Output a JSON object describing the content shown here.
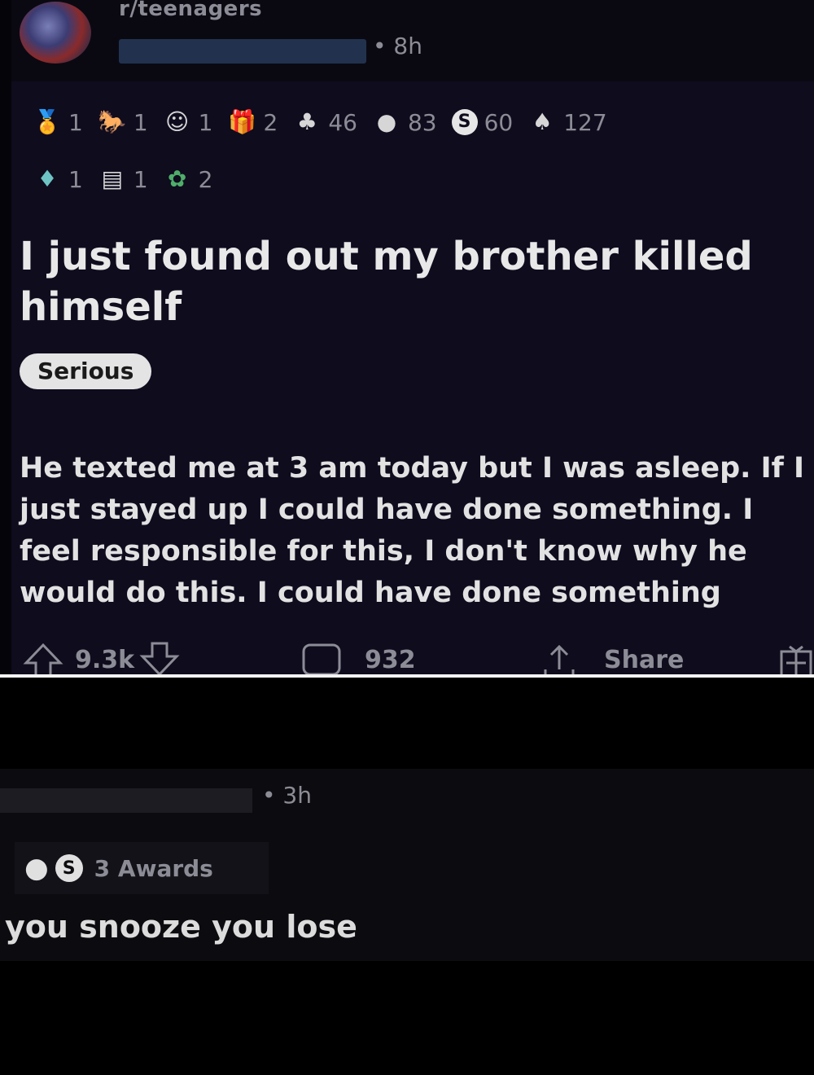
{
  "post": {
    "subreddit": "r/teenagers",
    "time": "• 8h",
    "awards_row1": [
      {
        "icon": "medal-icon",
        "glyph": "🏅",
        "count": "1",
        "tone": "gold"
      },
      {
        "icon": "horse-icon",
        "glyph": "🐎",
        "count": "1",
        "tone": ""
      },
      {
        "icon": "face-icon",
        "glyph": "☺",
        "count": "1",
        "tone": ""
      },
      {
        "icon": "gift-icon",
        "glyph": "🎁",
        "count": "2",
        "tone": ""
      },
      {
        "icon": "helpful-icon",
        "glyph": "♣",
        "count": "46",
        "tone": ""
      },
      {
        "icon": "wholesome-icon",
        "glyph": "●",
        "count": "83",
        "tone": ""
      },
      {
        "icon": "silver-coin-icon",
        "glyph": "S",
        "count": "60",
        "tone": "coin"
      },
      {
        "icon": "hug-icon",
        "glyph": "♠",
        "count": "127",
        "tone": ""
      }
    ],
    "awards_row2": [
      {
        "icon": "trophy-icon",
        "glyph": "♦",
        "count": "1",
        "tone": "teal"
      },
      {
        "icon": "scroll-icon",
        "glyph": "▤",
        "count": "1",
        "tone": ""
      },
      {
        "icon": "plant-icon",
        "glyph": "✿",
        "count": "2",
        "tone": "green"
      }
    ],
    "title": "I just found out my brother killed himself",
    "flair": "Serious",
    "body": "He texted me at 3 am today but I was asleep. If I just stayed up I could have done something. I feel responsible for this, I don't know why he would do this. I could have done something",
    "upvotes": "9.3k",
    "comments": "932",
    "share": "Share"
  },
  "comment": {
    "time": "• 3h",
    "awards_label": "3 Awards",
    "body": "you snooze you lose"
  }
}
